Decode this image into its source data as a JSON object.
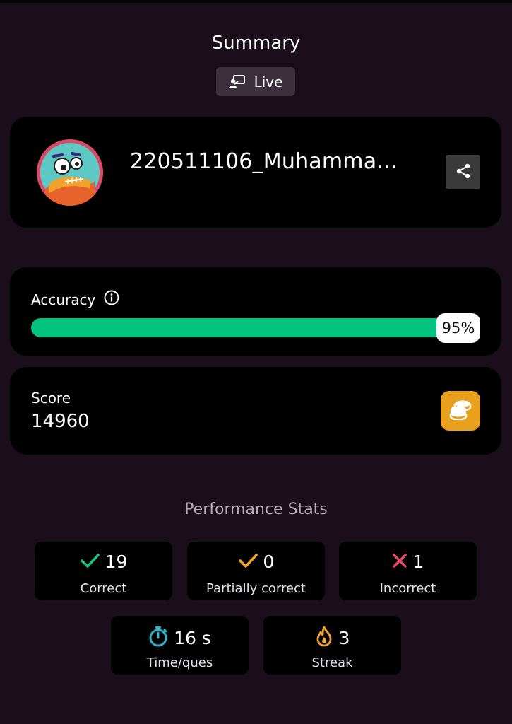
{
  "header": {
    "title": "Summary",
    "mode_badge": {
      "label": "Live",
      "icon": "live-presenter-icon"
    }
  },
  "profile": {
    "username": "220511106_Muhamma...",
    "avatar": "monster-avatar",
    "share_icon": "share-icon"
  },
  "accuracy": {
    "label": "Accuracy",
    "info_icon": "info-icon",
    "percent_text": "95%",
    "value": 0.95,
    "bar_color": "#00c47f"
  },
  "score": {
    "label": "Score",
    "value": "14960",
    "icon": "coins-icon",
    "icon_bg": "#e9a01c"
  },
  "performance": {
    "title": "Performance Stats",
    "stats": [
      {
        "value": "19",
        "label": "Correct",
        "icon": "check-icon",
        "color": "#19c37d"
      },
      {
        "value": "0",
        "label": "Partially correct",
        "icon": "check-icon",
        "color": "#f0a330"
      },
      {
        "value": "1",
        "label": "Incorrect",
        "icon": "cross-icon",
        "color": "#e5486a"
      },
      {
        "value": "16 s",
        "label": "Time/ques",
        "icon": "stopwatch-icon",
        "color": "#2fb3c9"
      },
      {
        "value": "3",
        "label": "Streak",
        "icon": "flame-icon",
        "color": "#f0a330"
      }
    ]
  }
}
